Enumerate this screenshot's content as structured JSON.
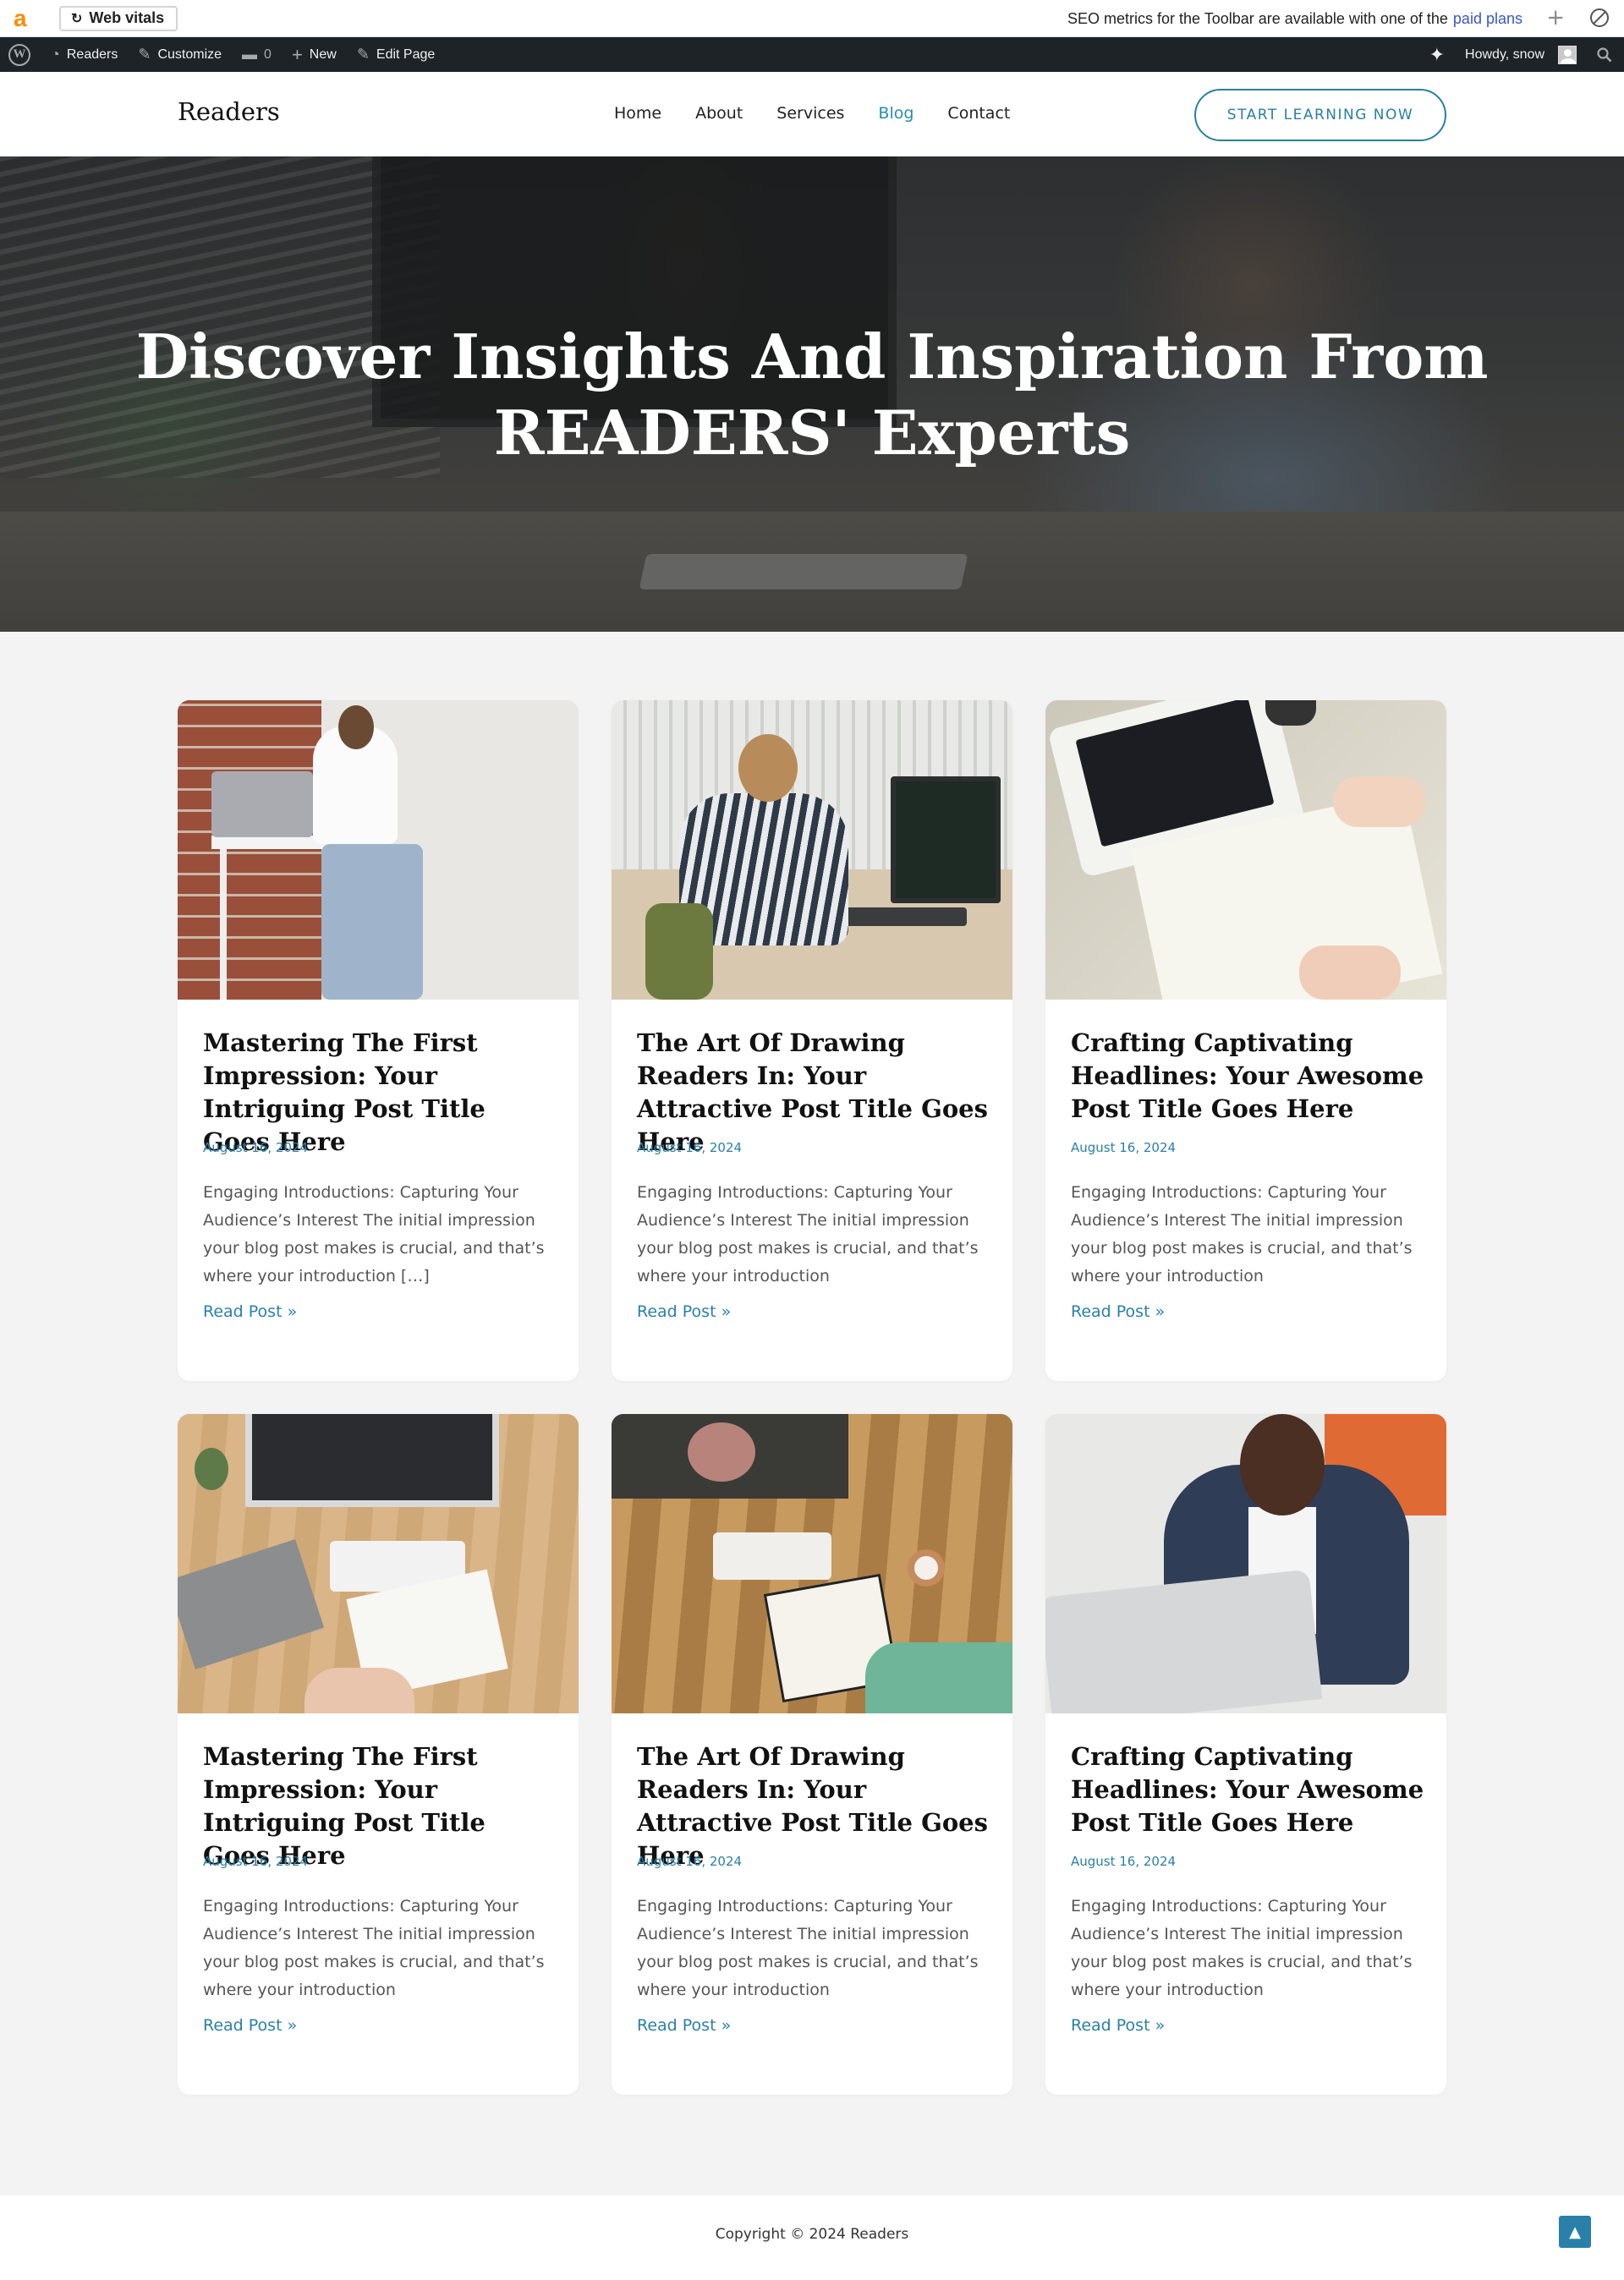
{
  "seo_toolbar": {
    "logo": "a",
    "web_vitals_label": "Web vitals",
    "message": "SEO metrics for the Toolbar are available with one of the",
    "link_text": "paid plans"
  },
  "admin_bar": {
    "site_name": "Readers",
    "customize": "Customize",
    "comments_count": "0",
    "new": "New",
    "edit_page": "Edit Page",
    "howdy": "Howdy, snow"
  },
  "header": {
    "site_title": "Readers",
    "nav": [
      {
        "label": "Home",
        "active": false
      },
      {
        "label": "About",
        "active": false
      },
      {
        "label": "Services",
        "active": false
      },
      {
        "label": "Blog",
        "active": true
      },
      {
        "label": "Contact",
        "active": false
      }
    ],
    "cta_label": "START LEARNING NOW"
  },
  "hero": {
    "title": "Discover Insights And Inspiration From READERS' Experts"
  },
  "posts": [
    {
      "title": "Mastering The First Impression: Your Intriguing Post Title Goes Here",
      "date": "August 16, 2024",
      "excerpt": "Engaging Introductions: Capturing Your Audience’s Interest The initial impression your blog post makes is crucial, and that’s where your introduction […]",
      "read_more": "Read Post »"
    },
    {
      "title": "The Art Of Drawing Readers In: Your Attractive Post Title Goes Here",
      "date": "August 16, 2024",
      "excerpt": "Engaging Introductions: Capturing Your Audience’s Interest The initial impression your blog post makes is crucial, and that’s where your introduction",
      "read_more": "Read Post »"
    },
    {
      "title": "Crafting Captivating Headlines: Your Awesome Post Title Goes Here",
      "date": "August 16, 2024",
      "excerpt": "Engaging Introductions: Capturing Your Audience’s Interest The initial impression your blog post makes is crucial, and that’s where your introduction",
      "read_more": "Read Post »"
    },
    {
      "title": "Mastering The First Impression: Your Intriguing Post Title Goes Here",
      "date": "August 16, 2024",
      "excerpt": "Engaging Introductions: Capturing Your Audience’s Interest The initial impression your blog post makes is crucial, and that’s where your introduction",
      "read_more": "Read Post »"
    },
    {
      "title": "The Art Of Drawing Readers In: Your Attractive Post Title Goes Here",
      "date": "August 16, 2024",
      "excerpt": "Engaging Introductions: Capturing Your Audience’s Interest The initial impression your blog post makes is crucial, and that’s where your introduction",
      "read_more": "Read Post »"
    },
    {
      "title": "Crafting Captivating Headlines: Your Awesome Post Title Goes Here",
      "date": "August 16, 2024",
      "excerpt": "Engaging Introductions: Capturing Your Audience’s Interest The initial impression your blog post makes is crucial, and that’s where your introduction",
      "read_more": "Read Post »"
    }
  ],
  "footer": {
    "copyright": "Copyright © 2024 Readers"
  },
  "colors": {
    "accent": "#2a80a8",
    "admin_bar": "#1d2327",
    "page_bg": "#f3f3f3"
  }
}
